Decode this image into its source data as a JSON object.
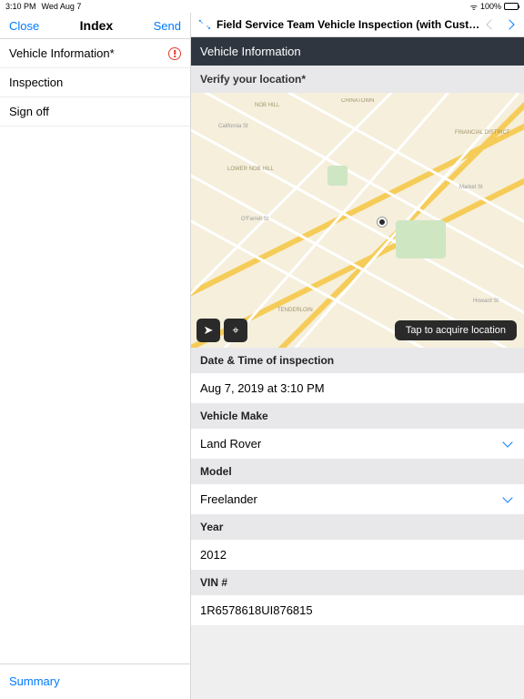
{
  "status": {
    "time": "3:10 PM",
    "date": "Wed Aug 7",
    "battery": "100%"
  },
  "sidebar": {
    "close": "Close",
    "title": "Index",
    "send": "Send",
    "items": [
      {
        "label": "Vehicle Information*",
        "alert": true
      },
      {
        "label": "Inspection"
      },
      {
        "label": "Sign off"
      }
    ],
    "footer": "Summary"
  },
  "content": {
    "docTitle": "Field Service Team Vehicle Inspection (with Custom Excel Ou...",
    "sectionTitle": "Vehicle Information",
    "locationLabel": "Verify your location*",
    "map": {
      "acquire": "Tap to acquire location"
    },
    "fields": {
      "datetime": {
        "label": "Date & Time of inspection",
        "value": "Aug 7, 2019 at 3:10 PM"
      },
      "make": {
        "label": "Vehicle Make",
        "value": "Land Rover"
      },
      "model": {
        "label": "Model",
        "value": "Freelander"
      },
      "year": {
        "label": "Year",
        "value": "2012"
      },
      "vin": {
        "label": "VIN #",
        "value": "1R6578618UI876815"
      }
    }
  }
}
